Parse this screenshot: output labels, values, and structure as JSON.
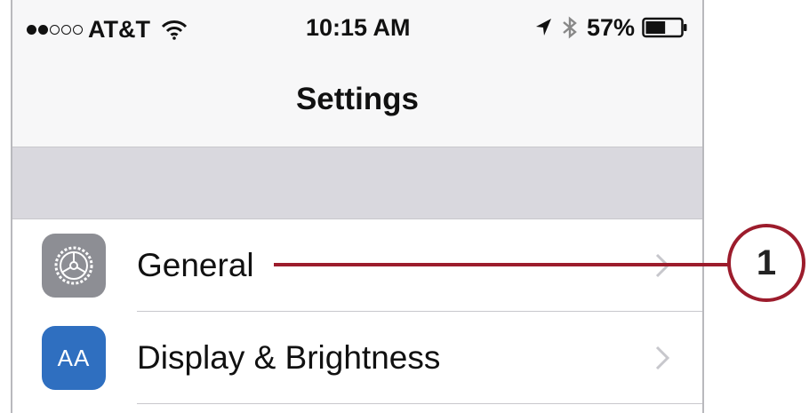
{
  "status_bar": {
    "carrier": "AT&T",
    "signal_bars": 2,
    "signal_max": 5,
    "time": "10:15 AM",
    "battery_percent_text": "57%",
    "battery_level": 0.57
  },
  "nav": {
    "title": "Settings"
  },
  "settings": {
    "items": [
      {
        "label": "General",
        "icon": "gear-icon",
        "icon_color": "#8d8e94"
      },
      {
        "label": "Display & Brightness",
        "icon": "display-brightness-icon",
        "icon_color": "#2f6fc0",
        "icon_text": "AA"
      }
    ]
  },
  "annotation": {
    "number": "1",
    "color": "#9c1c2c"
  }
}
